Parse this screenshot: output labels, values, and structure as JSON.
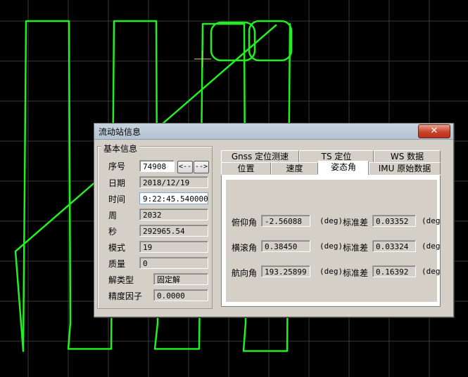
{
  "window": {
    "title": "流动站信息",
    "close_icon": "close-icon"
  },
  "basic_info": {
    "group_title": "基本信息",
    "fields": [
      {
        "label": "序号",
        "value": "74908"
      },
      {
        "label": "日期",
        "value": "2018/12/19"
      },
      {
        "label": "时间",
        "value": "9:22:45.540000"
      },
      {
        "label": "周",
        "value": "2032"
      },
      {
        "label": "秒",
        "value": "292965.54"
      },
      {
        "label": "模式",
        "value": "19"
      },
      {
        "label": "质量",
        "value": "0"
      },
      {
        "label": "解类型",
        "value": "固定解"
      },
      {
        "label": "精度因子",
        "value": "0.0000"
      }
    ],
    "prev_label": "<--",
    "next_label": "-->"
  },
  "tabs": {
    "row1": [
      "Gnss 定位测速",
      "TS 定位",
      "WS 数据"
    ],
    "row2": [
      "位置",
      "速度",
      "姿态角",
      "IMU 原始数据"
    ],
    "selected": "姿态角"
  },
  "attitude": {
    "rows": [
      {
        "label": "俯仰角",
        "value": "-2.56088",
        "unit": "(deg)",
        "std_label": "标准差",
        "std_value": "0.03352",
        "std_unit": "(deg)"
      },
      {
        "label": "横滚角",
        "value": "0.38450",
        "unit": "(deg)",
        "std_label": "标准差",
        "std_value": "0.03324",
        "std_unit": "(deg)"
      },
      {
        "label": "航向角",
        "value": "193.25899",
        "unit": "(deg)",
        "std_label": "标准差",
        "std_value": "0.16392",
        "std_unit": "(deg)"
      }
    ]
  },
  "colors": {
    "background": "#000000",
    "grid": "#3a3a3a",
    "track": "#22ee22",
    "crosshair": "#d8d870"
  }
}
